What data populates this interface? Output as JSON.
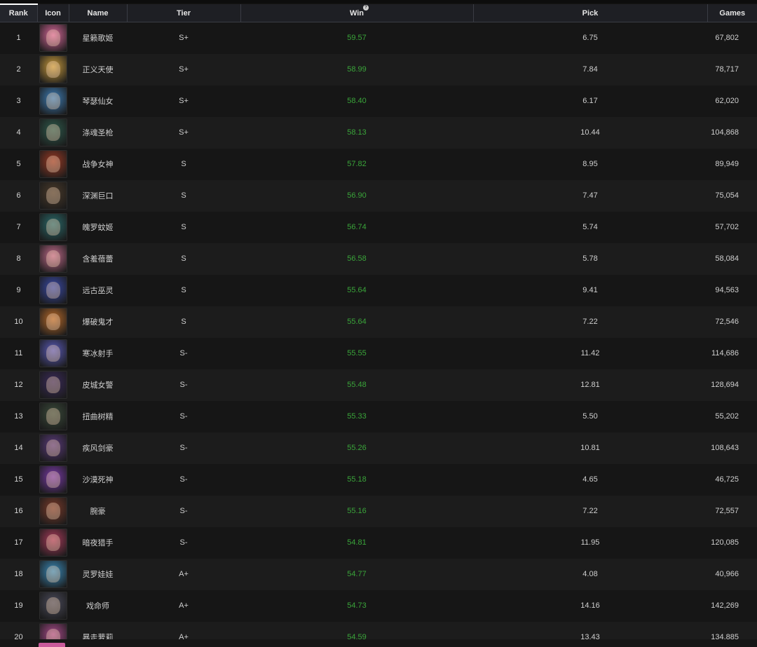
{
  "columns": {
    "rank": "Rank",
    "icon": "Icon",
    "name": "Name",
    "tier": "Tier",
    "win": "Win",
    "pick": "Pick",
    "games": "Games"
  },
  "rows": [
    {
      "rank": "1",
      "name": "星籁歌姬",
      "tier": "S+",
      "win": "59.57",
      "pick": "6.75",
      "games": "67,802",
      "icon_color": "#d8689a"
    },
    {
      "rank": "2",
      "name": "正义天使",
      "tier": "S+",
      "win": "58.99",
      "pick": "7.84",
      "games": "78,717",
      "icon_color": "#c99b3d"
    },
    {
      "rank": "3",
      "name": "琴瑟仙女",
      "tier": "S+",
      "win": "58.40",
      "pick": "6.17",
      "games": "62,020",
      "icon_color": "#3f7fb8"
    },
    {
      "rank": "4",
      "name": "涤魂圣枪",
      "tier": "S+",
      "win": "58.13",
      "pick": "10.44",
      "games": "104,868",
      "icon_color": "#2e5a4c"
    },
    {
      "rank": "5",
      "name": "战争女神",
      "tier": "S",
      "win": "57.82",
      "pick": "8.95",
      "games": "89,949",
      "icon_color": "#9a3a24"
    },
    {
      "rank": "6",
      "name": "深渊巨口",
      "tier": "S",
      "win": "56.90",
      "pick": "7.47",
      "games": "75,054",
      "icon_color": "#4a3a2a"
    },
    {
      "rank": "7",
      "name": "魄罗蚊姬",
      "tier": "S",
      "win": "56.74",
      "pick": "5.74",
      "games": "57,702",
      "icon_color": "#2a6a6a"
    },
    {
      "rank": "8",
      "name": "含羞蓓蕾",
      "tier": "S",
      "win": "56.58",
      "pick": "5.78",
      "games": "58,084",
      "icon_color": "#c06a8a"
    },
    {
      "rank": "9",
      "name": "远古巫灵",
      "tier": "S",
      "win": "55.64",
      "pick": "9.41",
      "games": "94,563",
      "icon_color": "#3a4aa8"
    },
    {
      "rank": "10",
      "name": "爆破鬼才",
      "tier": "S",
      "win": "55.64",
      "pick": "7.22",
      "games": "72,546",
      "icon_color": "#b86a2a"
    },
    {
      "rank": "11",
      "name": "寒冰射手",
      "tier": "S-",
      "win": "55.55",
      "pick": "11.42",
      "games": "114,686",
      "icon_color": "#5a5ab8"
    },
    {
      "rank": "12",
      "name": "皮城女警",
      "tier": "S-",
      "win": "55.48",
      "pick": "12.81",
      "games": "128,694",
      "icon_color": "#3a2a5a"
    },
    {
      "rank": "13",
      "name": "扭曲树精",
      "tier": "S-",
      "win": "55.33",
      "pick": "5.50",
      "games": "55,202",
      "icon_color": "#3a4a3a"
    },
    {
      "rank": "14",
      "name": "疾风剑豪",
      "tier": "S-",
      "win": "55.26",
      "pick": "10.81",
      "games": "108,643",
      "icon_color": "#5a3a7a"
    },
    {
      "rank": "15",
      "name": "沙漠死神",
      "tier": "S-",
      "win": "55.18",
      "pick": "4.65",
      "games": "46,725",
      "icon_color": "#7a3aa8"
    },
    {
      "rank": "16",
      "name": "腕豪",
      "tier": "S-",
      "win": "55.16",
      "pick": "7.22",
      "games": "72,557",
      "icon_color": "#7a3a2a"
    },
    {
      "rank": "17",
      "name": "暗夜猎手",
      "tier": "S-",
      "win": "54.81",
      "pick": "11.95",
      "games": "120,085",
      "icon_color": "#a83a5a"
    },
    {
      "rank": "18",
      "name": "灵罗娃娃",
      "tier": "A+",
      "win": "54.77",
      "pick": "4.08",
      "games": "40,966",
      "icon_color": "#3a8ab8"
    },
    {
      "rank": "19",
      "name": "戏命师",
      "tier": "A+",
      "win": "54.73",
      "pick": "14.16",
      "games": "142,269",
      "icon_color": "#4a4a5a"
    },
    {
      "rank": "20",
      "name": "暴走萝莉",
      "tier": "A+",
      "win": "54.59",
      "pick": "13.43",
      "games": "134,885",
      "icon_color": "#a84a8a"
    }
  ],
  "partial_row_icon_color": "#c85a9a"
}
